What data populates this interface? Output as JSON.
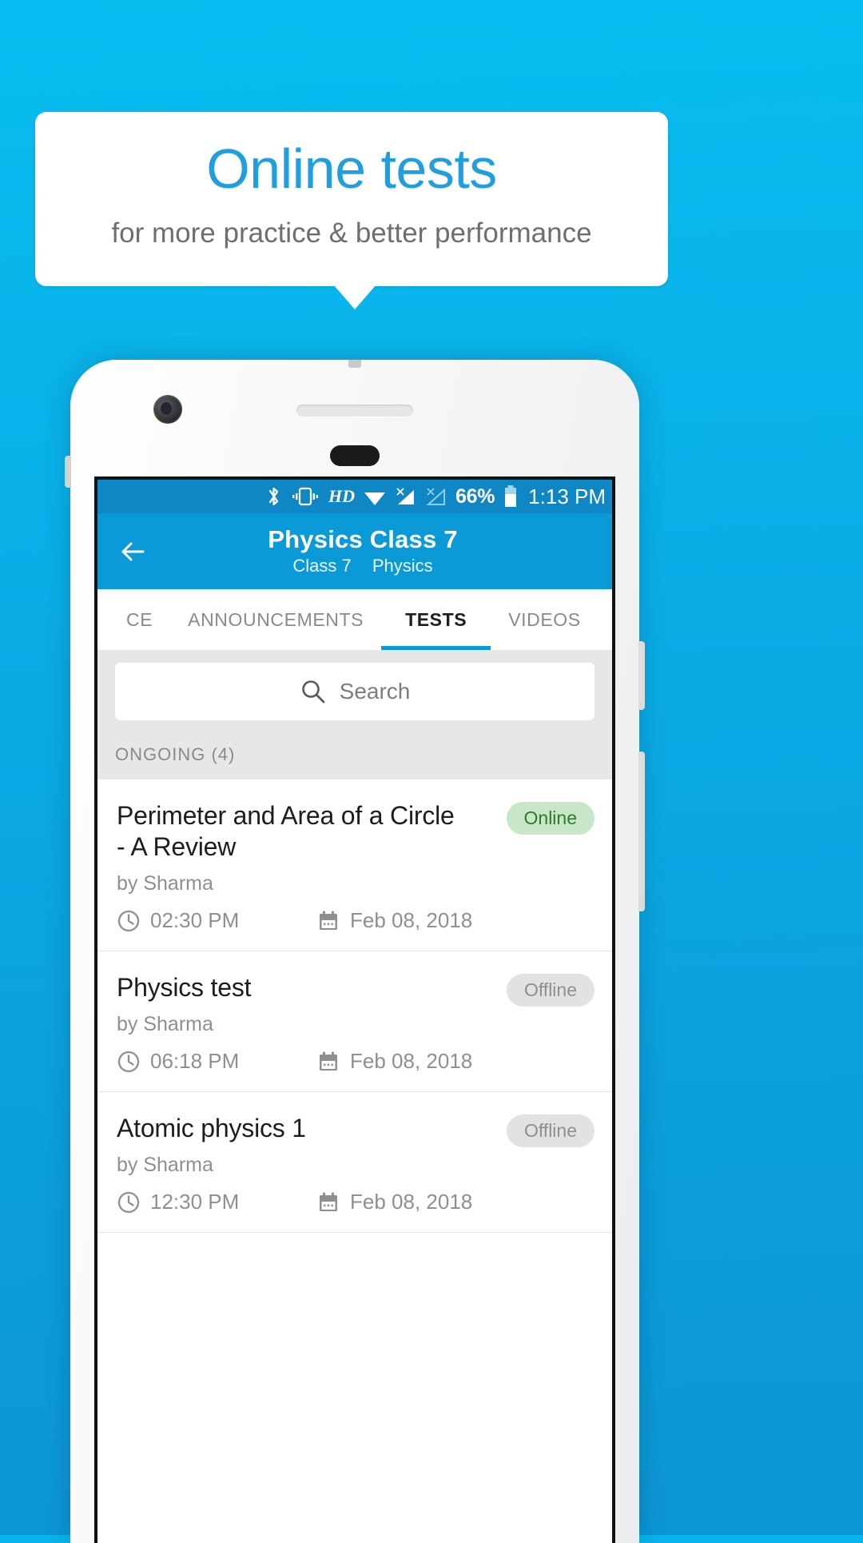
{
  "promo": {
    "title": "Online tests",
    "subtitle": "for more practice & better performance",
    "title_color": "#1f9fe0",
    "subtitle_color": "#6e6e6e",
    "background_color": "#0aa9e4"
  },
  "statusbar": {
    "icons": [
      "bluetooth-icon",
      "vibrate-icon",
      "wifi-icon",
      "signal-no-sim-icon",
      "signal-no-service-icon",
      "battery-icon"
    ],
    "hd_label": "HD",
    "battery_percent": "66%",
    "time": "1:13 PM",
    "background_color": "#0f87c4"
  },
  "toolbar": {
    "back_icon": "back-arrow-icon",
    "title": "Physics Class 7",
    "subtitle_class": "Class 7",
    "subtitle_subject": "Physics",
    "background_color": "#0a9ad8"
  },
  "tabs": {
    "active_index": 2,
    "accent_color": "#0a9ad8",
    "items": [
      {
        "label": "CE"
      },
      {
        "label": "ANNOUNCEMENTS"
      },
      {
        "label": "TESTS"
      },
      {
        "label": "VIDEOS"
      }
    ]
  },
  "search": {
    "icon": "search-icon",
    "placeholder": "Search",
    "value": ""
  },
  "section": {
    "header": "ONGOING (4)"
  },
  "tests": [
    {
      "title": "Perimeter and Area of a Circle - A Review",
      "author": "by Sharma",
      "time": "02:30 PM",
      "date": "Feb 08, 2018",
      "status": "Online",
      "status_kind": "online"
    },
    {
      "title": "Physics test",
      "author": "by Sharma",
      "time": "06:18 PM",
      "date": "Feb 08, 2018",
      "status": "Offline",
      "status_kind": "offline"
    },
    {
      "title": "Atomic physics 1",
      "author": "by Sharma",
      "time": "12:30 PM",
      "date": "Feb 08, 2018",
      "status": "Offline",
      "status_kind": "offline"
    }
  ]
}
